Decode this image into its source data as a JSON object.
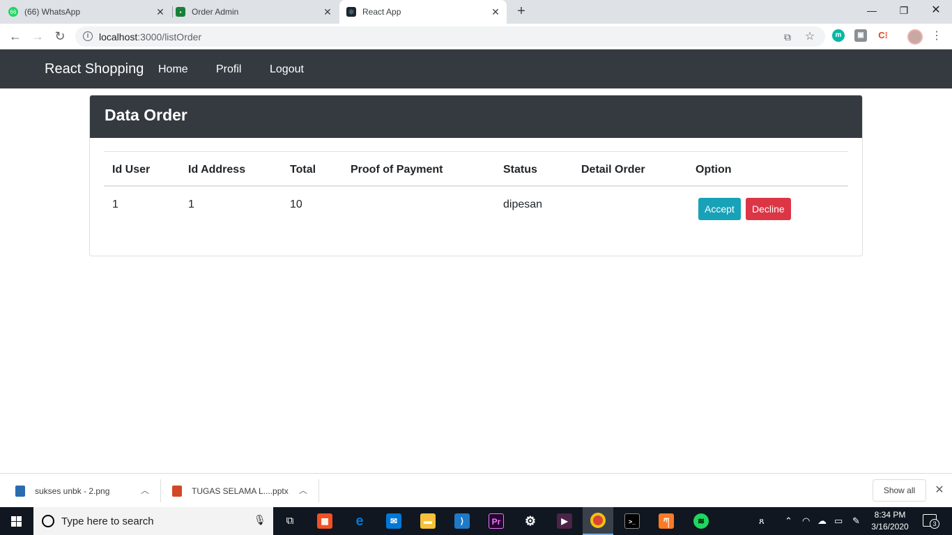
{
  "browser": {
    "tabs": [
      {
        "title": "(66) WhatsApp",
        "favicon_text": "66",
        "favicon_color": "#25d366"
      },
      {
        "title": "Order Admin",
        "favicon_text": "",
        "favicon_color": "#188038"
      },
      {
        "title": "React App",
        "favicon_text": "⚛",
        "favicon_color": "#20232a"
      }
    ],
    "url_host": "localhost",
    "url_path": ":3000/listOrder"
  },
  "navbar": {
    "brand": "React Shopping",
    "links": [
      "Home",
      "Profil",
      "Logout"
    ]
  },
  "card": {
    "title": "Data Order",
    "columns": [
      "Id User",
      "Id Address",
      "Total",
      "Proof of Payment",
      "Status",
      "Detail Order",
      "Option"
    ],
    "rows": [
      {
        "id_user": "1",
        "id_address": "1",
        "total": "10",
        "proof_of_payment": "",
        "status": "dipesan",
        "detail_order": ""
      }
    ],
    "accept_label": "Accept",
    "decline_label": "Decline"
  },
  "downloads": {
    "items": [
      "sukses unbk - 2.png",
      "TUGAS SELAMA L....pptx"
    ],
    "show_all": "Show all"
  },
  "taskbar": {
    "search_placeholder": "Type here to search",
    "time": "8:34 PM",
    "date": "3/16/2020",
    "notification_count": "3"
  },
  "colors": {
    "navbar_bg": "#343a40",
    "accept": "#17a2b8",
    "decline": "#dc3545"
  }
}
